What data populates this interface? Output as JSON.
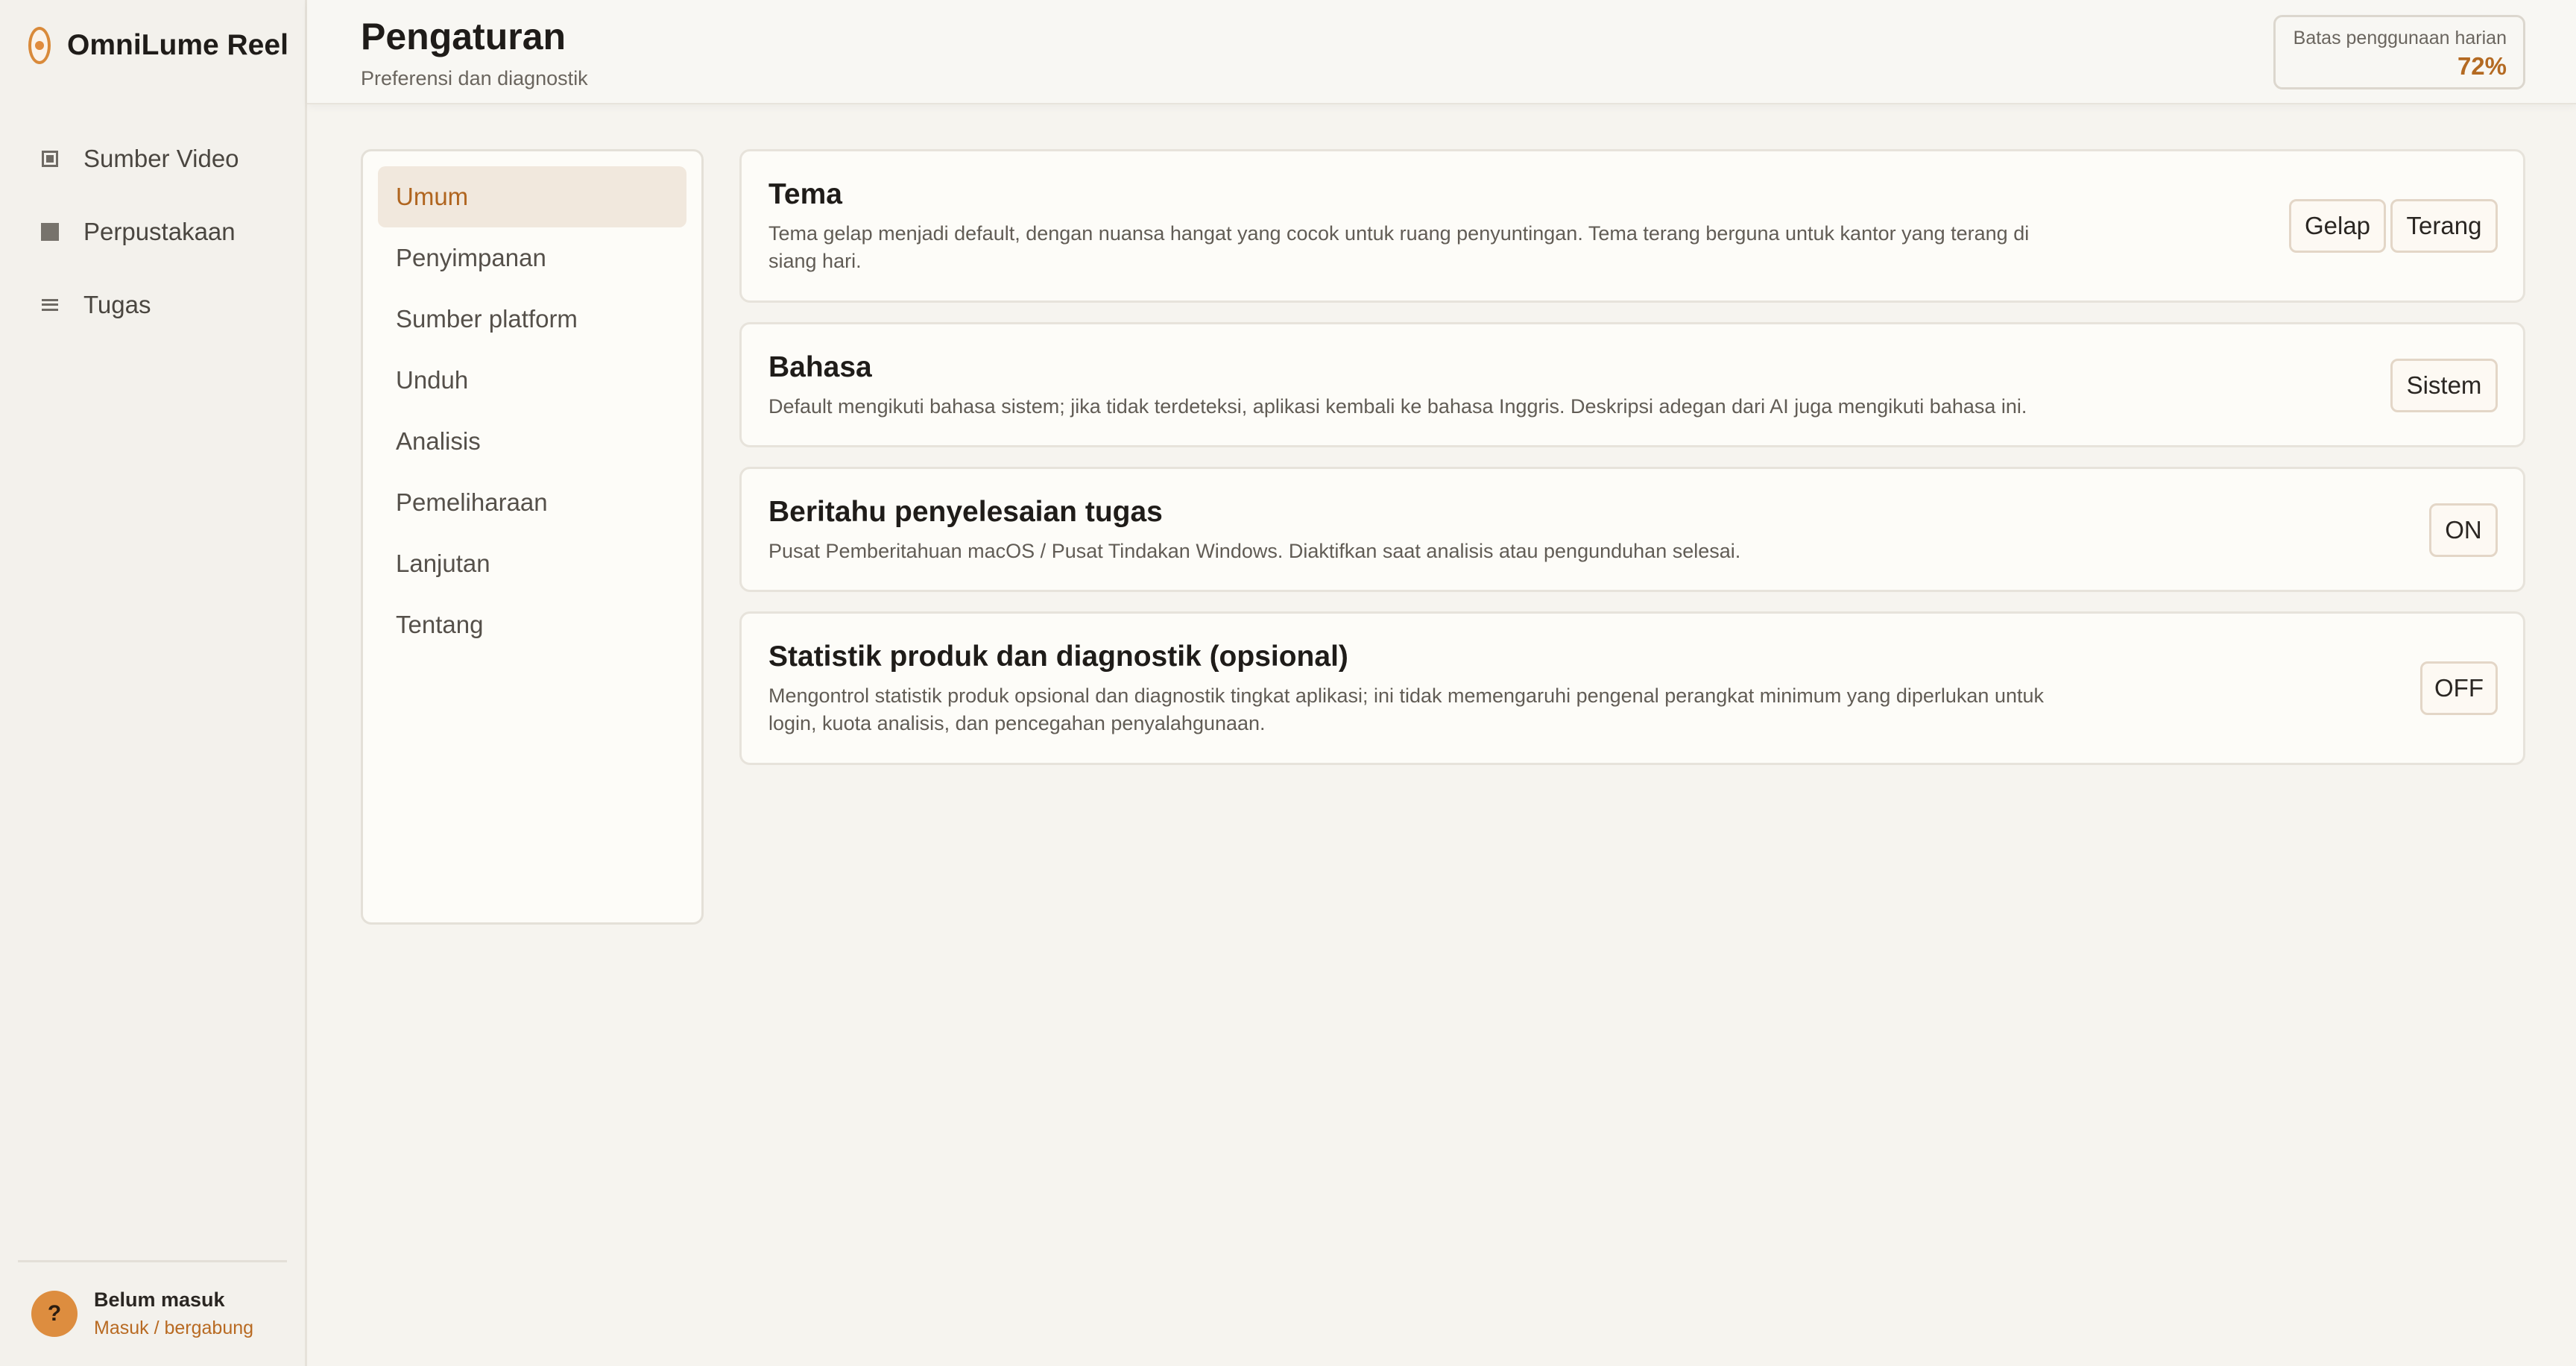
{
  "app": {
    "name": "OmniLume Reel"
  },
  "sidebar": {
    "items": [
      {
        "label": "Sumber Video",
        "icon": "video-source-icon"
      },
      {
        "label": "Perpustakaan",
        "icon": "library-icon"
      },
      {
        "label": "Tugas",
        "icon": "tasks-icon"
      }
    ],
    "user": {
      "avatar": "?",
      "status": "Belum masuk",
      "link": "Masuk / bergabung"
    }
  },
  "header": {
    "title": "Pengaturan",
    "subtitle": "Preferensi dan diagnostik",
    "usage": {
      "label": "Batas penggunaan harian",
      "value": "72%"
    }
  },
  "settings_nav": {
    "active": "Umum",
    "items": [
      "Umum",
      "Penyimpanan",
      "Sumber platform",
      "Unduh",
      "Analisis",
      "Pemeliharaan",
      "Lanjutan",
      "Tentang"
    ]
  },
  "settings": [
    {
      "title": "Tema",
      "description": "Tema gelap menjadi default, dengan nuansa hangat yang cocok untuk ruang penyuntingan. Tema terang berguna untuk kantor yang terang di siang hari.",
      "options": [
        "Gelap",
        "Terang"
      ]
    },
    {
      "title": "Bahasa",
      "description": "Default mengikuti bahasa sistem; jika tidak terdeteksi, aplikasi kembali ke bahasa Inggris. Deskripsi adegan dari AI juga mengikuti bahasa ini.",
      "options": [
        "Sistem"
      ]
    },
    {
      "title": "Beritahu penyelesaian tugas",
      "description": "Pusat Pemberitahuan macOS / Pusat Tindakan Windows. Diaktifkan saat analisis atau pengunduhan selesai.",
      "options": [
        "ON"
      ]
    },
    {
      "title": "Statistik produk dan diagnostik (opsional)",
      "description": "Mengontrol statistik produk opsional dan diagnostik tingkat aplikasi; ini tidak memengaruhi pengenal perangkat minimum yang diperlukan untuk login, kuota analisis, dan pencegahan penyalahgunaan.",
      "options": [
        "OFF"
      ]
    }
  ],
  "colors": {
    "accent": "#d98a3a",
    "accent_text": "#b46a22",
    "active_nav_bg": "#f1e8dd",
    "background": "#f6f4ef"
  }
}
